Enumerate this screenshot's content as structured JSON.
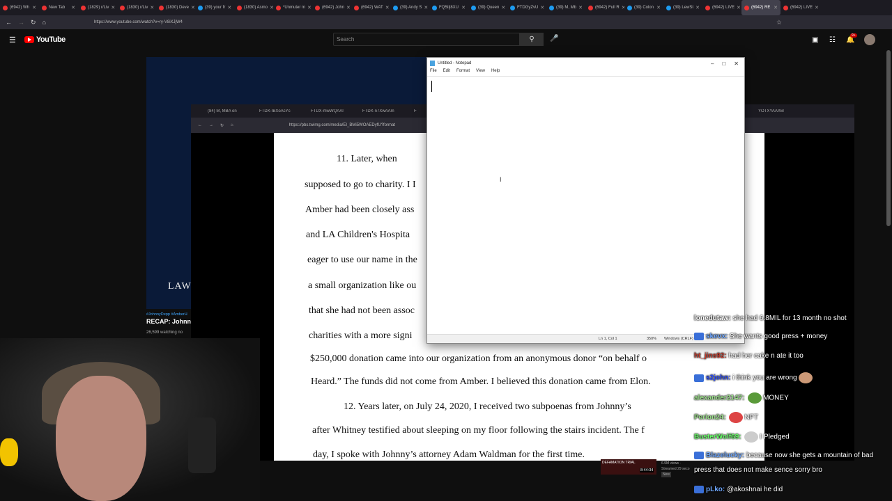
{
  "browser": {
    "tabs": [
      {
        "label": "(6942) Wh",
        "icon": "youtube-icon"
      },
      {
        "label": "New Tab",
        "icon": "firefox-icon"
      },
      {
        "label": "(1829) r/Liv",
        "icon": "reddit-icon"
      },
      {
        "label": "(1830) r/Liv",
        "icon": "reddit-icon"
      },
      {
        "label": "(1830) Deve",
        "icon": "reddit-icon"
      },
      {
        "label": "(39) your fr",
        "icon": "twitter-icon"
      },
      {
        "label": "(1830) Asmo",
        "icon": "reddit-icon"
      },
      {
        "label": "*Unmuter m",
        "icon": "reddit-icon"
      },
      {
        "label": "(6942) John",
        "icon": "youtube-icon"
      },
      {
        "label": "(6942) WAT",
        "icon": "youtube-icon"
      },
      {
        "label": "(39) Andy S",
        "icon": "twitter-icon"
      },
      {
        "label": "FQ5tIj8XU",
        "icon": "twitter-icon"
      },
      {
        "label": "(39) Queen",
        "icon": "twitter-icon"
      },
      {
        "label": "FTDGyZvU",
        "icon": "twitter-icon"
      },
      {
        "label": "(39) M, Mb",
        "icon": "twitter-icon"
      },
      {
        "label": "(6942) Full R",
        "icon": "youtube-icon"
      },
      {
        "label": "(39) Colon",
        "icon": "twitter-icon"
      },
      {
        "label": "(39) LewSt",
        "icon": "twitter-icon"
      },
      {
        "label": "(6942) LIVE",
        "icon": "youtube-icon"
      },
      {
        "label": "(6942) RE",
        "icon": "youtube-icon"
      },
      {
        "label": "(6942) LIVE",
        "icon": "youtube-icon"
      }
    ],
    "url": "https://www.youtube.com/watch?v=ry-V8iXJjW4"
  },
  "youtube": {
    "logo": "YouTube",
    "search_placeholder": "Search",
    "notification_count": "9+",
    "video_overlay_text": "LAW",
    "rec_tags": "#JohnnyDepp #AmberH",
    "rec_title": "RECAP: Johnny",
    "rec_watching": "26,599 watching no",
    "thumb_title": "DEFAMATION TRIAL",
    "thumb_time": "8:44:34",
    "thumb_views": "6.9M views ·",
    "thumb_streamed": "Streamed 29 seco",
    "thumb_new": "New"
  },
  "second_window": {
    "tabs": [
      "(84) M, MBA on",
      "FTDX-IBXoAcYc",
      "FTDX-mwWQAAl",
      "FTDX-n7XwAAm",
      "F",
      "YOTXYAAX6I"
    ],
    "url": "https://pbs.twimg.com/media/EI_BMi5WOAEDyfU?format"
  },
  "document": {
    "lines": [
      "11.     Later, when",
      "supposed to go to charity. I I",
      "Amber had been closely ass",
      "and LA Children's Hospita",
      "eager to use our name in the",
      "a small organization like ou",
      "that she had not been assoc",
      "charities with a more signi",
      "$250,000 donation came into our organization from an anonymous donor “on behalf o",
      "Heard.” The funds did not come from Amber. I believed this donation came from Elon.",
      "12.     Years later, on July 24, 2020, I received two subpoenas from Johnny’s",
      "after Whitney testified about sleeping on my floor following the stairs incident.   The f",
      "day, I spoke with Johnny’s attorney Adam Waldman for the first time."
    ]
  },
  "notepad": {
    "title": "Untitled - Notepad",
    "menu": [
      "File",
      "Edit",
      "Format",
      "View",
      "Help"
    ],
    "status_position": "Ln 1, Col 1",
    "status_zoom": "350%",
    "status_eol": "Windows (CRLF)"
  },
  "chat": {
    "messages": [
      {
        "user": "lonedutaw:",
        "text": "she had 6.8MIL for 13 month no shot",
        "user_color": "#ffffff"
      },
      {
        "user": "skevx:",
        "text": "She wants good press + money",
        "user_color": "#6fa8ff"
      },
      {
        "user": "ht_jins92:",
        "text": "had her cake n ate it too",
        "user_color": "#c0392b"
      },
      {
        "user": "s2john:",
        "text": "i think you are wrong",
        "user_color": "#2a4dff"
      },
      {
        "user": "alexander2147:",
        "text": "MONEY",
        "user_color": "#9be08a"
      },
      {
        "user": "Perion24:",
        "text": "NFT",
        "user_color": "#9be08a"
      },
      {
        "user": "BusterWolf69:",
        "text": "I Pledged",
        "user_color": "#66ff66"
      },
      {
        "user": "Blazelucky:",
        "text": "because now she gets a mountain of bad",
        "user_color": "#6fa8ff"
      },
      {
        "user": "",
        "text": "press that does not make sence sorry bro",
        "user_color": "#ffffff"
      },
      {
        "user": "pLko:",
        "text": "@akoshnai he did",
        "user_color": "#6fa8ff"
      }
    ]
  }
}
